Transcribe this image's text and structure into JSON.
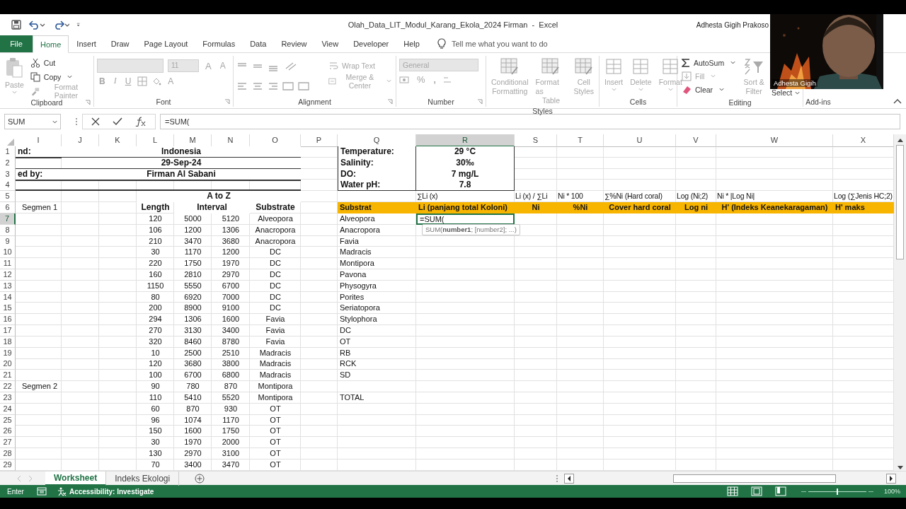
{
  "title_bar": {
    "title": "Olah_Data_LIT_Modul_Karang_Ekola_2024 Firman  -  Excel",
    "user": "Adhesta Gigih Prakoso"
  },
  "video_tile": {
    "kind": "picture",
    "name": "Adhesta Gigih"
  },
  "ribbon_tabs": [
    {
      "label": "File",
      "kind": "file",
      "selected": false
    },
    {
      "label": "Home",
      "kind": "tab",
      "selected": true
    },
    {
      "label": "Insert",
      "kind": "tab",
      "selected": false
    },
    {
      "label": "Draw",
      "kind": "tab",
      "selected": false
    },
    {
      "label": "Page Layout",
      "kind": "tab",
      "selected": false
    },
    {
      "label": "Formulas",
      "kind": "tab",
      "selected": false
    },
    {
      "label": "Data",
      "kind": "tab",
      "selected": false
    },
    {
      "label": "Review",
      "kind": "tab",
      "selected": false
    },
    {
      "label": "View",
      "kind": "tab",
      "selected": false
    },
    {
      "label": "Developer",
      "kind": "tab",
      "selected": false
    },
    {
      "label": "Help",
      "kind": "tab",
      "selected": false
    }
  ],
  "tell_me": {
    "placeholder": "Tell me what you want to do"
  },
  "clipboard": {
    "label": "Clipboard",
    "paste": {
      "label": "Paste",
      "disabled": true
    },
    "cut": {
      "label": "Cut",
      "disabled": false
    },
    "copy": {
      "label": "Copy",
      "disabled": false
    },
    "format_painter": {
      "label": "Format Painter",
      "disabled": true
    }
  },
  "font": {
    "label": "Font",
    "size": "11",
    "grow": "A",
    "shrink": "A",
    "bold": "B",
    "italic": "I",
    "underline": "U",
    "font_color_button": "A",
    "disabled": true
  },
  "alignment": {
    "label": "Alignment",
    "wrap_text": "Wrap Text",
    "merge_center": "Merge & Center",
    "disabled": true
  },
  "number": {
    "label": "Number",
    "format": "General",
    "percent": "%",
    "comma": ",",
    "disabled": true
  },
  "styles": {
    "label": "Styles",
    "buttons": [
      {
        "lines": [
          "Conditional",
          "Formatting"
        ],
        "disabled": true
      },
      {
        "lines": [
          "Format as",
          "Table"
        ],
        "disabled": true
      },
      {
        "lines": [
          "Cell",
          "Styles"
        ],
        "disabled": true
      }
    ]
  },
  "cells": {
    "label": "Cells",
    "buttons": [
      {
        "label": "Insert",
        "disabled": true
      },
      {
        "label": "Delete",
        "disabled": true
      },
      {
        "label": "Format",
        "disabled": true
      }
    ]
  },
  "editing": {
    "label": "Editing",
    "autosum": {
      "label": "AutoSum",
      "disabled": false
    },
    "fill": {
      "label": "Fill",
      "disabled": true
    },
    "clear": {
      "label": "Clear",
      "disabled": false
    },
    "sort_filter": {
      "lines": [
        "Sort &",
        "Filter"
      ],
      "disabled": true
    },
    "select": {
      "label": "Select",
      "disabled": false
    }
  },
  "add_ins": {
    "label": "Add-ins"
  },
  "formula_bar": {
    "name_box": "SUM",
    "formula": "=SUM("
  },
  "columns": [
    {
      "letter": "I",
      "selected": false
    },
    {
      "letter": "J",
      "selected": false
    },
    {
      "letter": "K",
      "selected": false
    },
    {
      "letter": "L",
      "selected": false
    },
    {
      "letter": "M",
      "selected": false
    },
    {
      "letter": "N",
      "selected": false
    },
    {
      "letter": "O",
      "selected": false
    },
    {
      "letter": "P",
      "selected": false
    },
    {
      "letter": "Q",
      "selected": false
    },
    {
      "letter": "R",
      "selected": true
    },
    {
      "letter": "S",
      "selected": false
    },
    {
      "letter": "T",
      "selected": false
    },
    {
      "letter": "U",
      "selected": false
    },
    {
      "letter": "V",
      "selected": false
    },
    {
      "letter": "W",
      "selected": false
    },
    {
      "letter": "X",
      "selected": false
    }
  ],
  "rows": [
    {
      "number": "1",
      "kind": "info",
      "selected": false,
      "i": "nd:",
      "jo": "Indonesia",
      "q": "Temperature:",
      "r": "29 °C"
    },
    {
      "number": "2",
      "kind": "info",
      "selected": false,
      "jo": "29-Sep-24",
      "q": "Salinity:",
      "r": "30‰"
    },
    {
      "number": "3",
      "kind": "info",
      "selected": false,
      "i": "ed by:",
      "jo": "Firman Al Sabani",
      "q": "DO:",
      "r": "7 mg/L"
    },
    {
      "number": "4",
      "kind": "info",
      "selected": false,
      "q": "Water pH:",
      "r": "7.8"
    },
    {
      "number": "5",
      "kind": "formulas",
      "selected": false,
      "lo": "A to Z",
      "r": "∑Li (x)",
      "s": "Li (x) / ∑Li",
      "t": "Ni * 100",
      "u": "∑%Ni (Hard coral)",
      "v": "Log (Ni;2)",
      "w": "Ni * |Log Ni|",
      "x": "Log (∑Jenis HC;2)"
    },
    {
      "number": "6",
      "kind": "header",
      "selected": false,
      "i": "Segmen 1",
      "l": "Length",
      "mn": "Interval",
      "o": "Substrate",
      "q": "Substrat",
      "r": "Li (panjang total Koloni)",
      "s": "Ni",
      "t": "%Ni",
      "u": "Cover hard coral",
      "v": "Log ni",
      "w": "H' (Indeks Keanekaragaman)",
      "x": "H' maks"
    },
    {
      "number": "7",
      "kind": "data",
      "selected": true,
      "l": "120",
      "m": "5000",
      "n": "5120",
      "o": "Alveopora",
      "q": "Alveopora",
      "r": "=SUM(",
      "tooltip": "SUM(**number1**; [number2]; ...)"
    },
    {
      "number": "8",
      "kind": "data",
      "selected": false,
      "l": "106",
      "m": "1200",
      "n": "1306",
      "o": "Anacropora",
      "q": "Anacropora"
    },
    {
      "number": "9",
      "kind": "data",
      "selected": false,
      "l": "210",
      "m": "3470",
      "n": "3680",
      "o": "Anacropora",
      "q": "Favia"
    },
    {
      "number": "10",
      "kind": "data",
      "selected": false,
      "l": "30",
      "m": "1170",
      "n": "1200",
      "o": "DC",
      "q": "Madracis"
    },
    {
      "number": "11",
      "kind": "data",
      "selected": false,
      "l": "220",
      "m": "1750",
      "n": "1970",
      "o": "DC",
      "q": "Montipora"
    },
    {
      "number": "12",
      "kind": "data",
      "selected": false,
      "l": "160",
      "m": "2810",
      "n": "2970",
      "o": "DC",
      "q": "Pavona"
    },
    {
      "number": "13",
      "kind": "data",
      "selected": false,
      "l": "1150",
      "m": "5550",
      "n": "6700",
      "o": "DC",
      "q": "Physogyra"
    },
    {
      "number": "14",
      "kind": "data",
      "selected": false,
      "l": "80",
      "m": "6920",
      "n": "7000",
      "o": "DC",
      "q": "Porites"
    },
    {
      "number": "15",
      "kind": "data",
      "selected": false,
      "l": "200",
      "m": "8900",
      "n": "9100",
      "o": "DC",
      "q": "Seriatopora"
    },
    {
      "number": "16",
      "kind": "data",
      "selected": false,
      "l": "294",
      "m": "1306",
      "n": "1600",
      "o": "Favia",
      "q": "Stylophora"
    },
    {
      "number": "17",
      "kind": "data",
      "selected": false,
      "l": "270",
      "m": "3130",
      "n": "3400",
      "o": "Favia",
      "q": "DC"
    },
    {
      "number": "18",
      "kind": "data",
      "selected": false,
      "l": "320",
      "m": "8460",
      "n": "8780",
      "o": "Favia",
      "q": "OT"
    },
    {
      "number": "19",
      "kind": "data",
      "selected": false,
      "l": "10",
      "m": "2500",
      "n": "2510",
      "o": "Madracis",
      "q": "RB"
    },
    {
      "number": "20",
      "kind": "data",
      "selected": false,
      "l": "120",
      "m": "3680",
      "n": "3800",
      "o": "Madracis",
      "q": "RCK"
    },
    {
      "number": "21",
      "kind": "data",
      "selected": false,
      "l": "100",
      "m": "6700",
      "n": "6800",
      "o": "Madracis",
      "q": "SD"
    },
    {
      "number": "22",
      "kind": "data",
      "selected": false,
      "i": "Segmen 2",
      "l": "90",
      "m": "780",
      "n": "870",
      "o": "Montipora"
    },
    {
      "number": "23",
      "kind": "data",
      "selected": false,
      "l": "110",
      "m": "5410",
      "n": "5520",
      "o": "Montipora",
      "q": "TOTAL"
    },
    {
      "number": "24",
      "kind": "data",
      "selected": false,
      "l": "60",
      "m": "870",
      "n": "930",
      "o": "OT"
    },
    {
      "number": "25",
      "kind": "data",
      "selected": false,
      "l": "96",
      "m": "1074",
      "n": "1170",
      "o": "OT"
    },
    {
      "number": "26",
      "kind": "data",
      "selected": false,
      "l": "150",
      "m": "1600",
      "n": "1750",
      "o": "OT"
    },
    {
      "number": "27",
      "kind": "data",
      "selected": false,
      "l": "30",
      "m": "1970",
      "n": "2000",
      "o": "OT"
    },
    {
      "number": "28",
      "kind": "data",
      "selected": false,
      "l": "130",
      "m": "2970",
      "n": "3100",
      "o": "OT"
    },
    {
      "number": "29",
      "kind": "data",
      "selected": false,
      "l": "70",
      "m": "3400",
      "n": "3470",
      "o": "OT"
    }
  ],
  "sheet_tabs": [
    {
      "label": "Worksheet",
      "selected": true
    },
    {
      "label": "Indeks Ekologi",
      "selected": false
    }
  ],
  "status_bar": {
    "mode": "Enter",
    "accessibility": "Accessibility: Investigate",
    "zoom": {
      "level": 0.5
    },
    "zoom_text": "100%"
  }
}
